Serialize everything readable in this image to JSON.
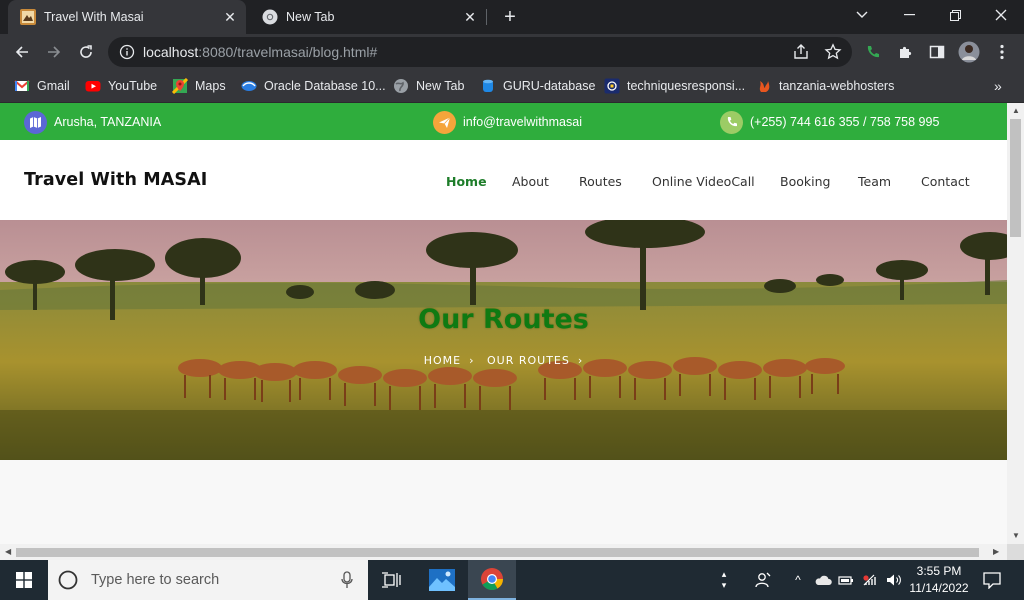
{
  "browser": {
    "tabs": [
      {
        "title": "Travel With Masai",
        "active": true,
        "icon": "safari-tab-icon"
      },
      {
        "title": "New Tab",
        "active": false,
        "icon": "chrome-icon"
      }
    ],
    "url_host": "localhost",
    "url_path": ":8080/travelmasai/blog.html#",
    "bookmarks": [
      {
        "label": "Gmail",
        "icon": "gmail-icon"
      },
      {
        "label": "YouTube",
        "icon": "youtube-icon"
      },
      {
        "label": "Maps",
        "icon": "maps-icon"
      },
      {
        "label": "Oracle Database 10...",
        "icon": "oracle-icon"
      },
      {
        "label": "New Tab",
        "icon": "globe-icon"
      },
      {
        "label": "GURU-database",
        "icon": "database-icon"
      },
      {
        "label": "techniquesresponsi...",
        "icon": "techniques-icon"
      },
      {
        "label": "tanzania-webhosters",
        "icon": "webhosters-icon"
      }
    ]
  },
  "site": {
    "topbar": {
      "location": "Arusha, TANZANIA",
      "email": "info@travelwithmasai",
      "phone": "(+255) 744 616 355 / 758 758 995"
    },
    "logo": "Travel With MASAI",
    "nav": [
      "Home",
      "About",
      "Routes",
      "Online VideoCall",
      "Booking",
      "Team",
      "Contact"
    ],
    "active_nav": "Home",
    "hero": {
      "title": "Our Routes",
      "crumb_home": "HOME",
      "crumb_current": "OUR ROUTES"
    },
    "colors": {
      "topbar": "#2fad3d",
      "accent": "#1e7d2a",
      "hero_title": "#0f7a12"
    }
  },
  "taskbar": {
    "search_placeholder": "Type here to search",
    "time": "3:55 PM",
    "date": "11/14/2022"
  }
}
